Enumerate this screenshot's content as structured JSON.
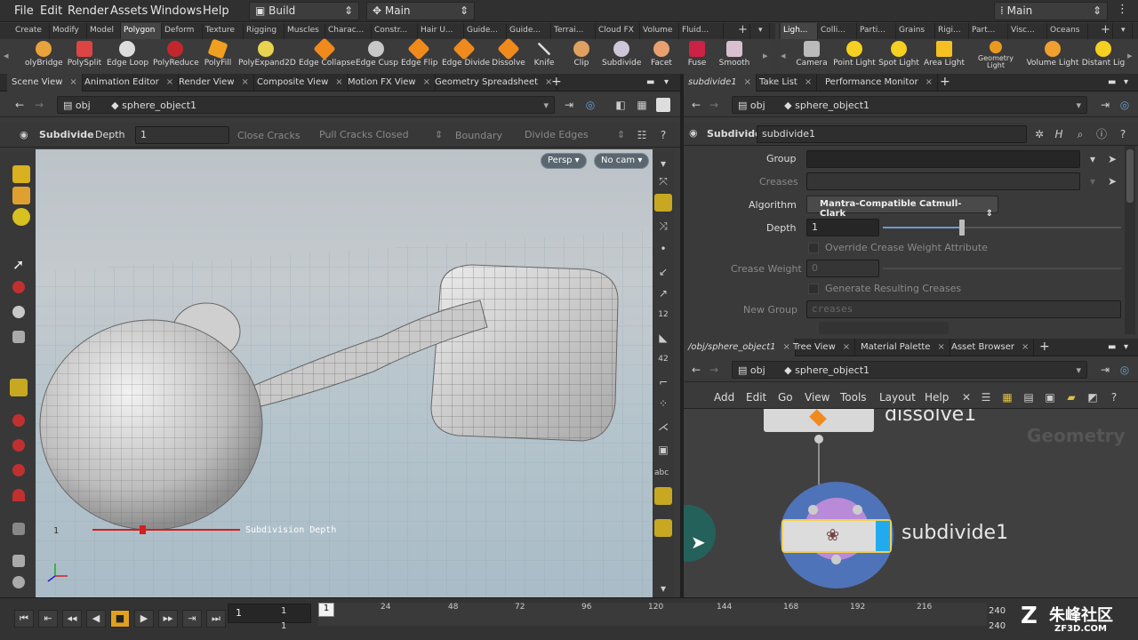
{
  "menubar": {
    "items": [
      "File",
      "Edit",
      "Render",
      "Assets",
      "Windows",
      "Help"
    ],
    "desktop": "Build",
    "context": "Main",
    "right_desktop": "Main"
  },
  "shelf_tabs_left": [
    "Create",
    "Modify",
    "Model",
    "Polygon",
    "Deform",
    "Texture",
    "Rigging",
    "Muscles",
    "Charac...",
    "Constr...",
    "Hair U...",
    "Guide...",
    "Guide...",
    "Terrai...",
    "Cloud FX",
    "Volume",
    "Fluid..."
  ],
  "shelf_tabs_right": [
    "Ligh...",
    "Colli...",
    "Parti...",
    "Grains",
    "Rigi...",
    "Part...",
    "Visc...",
    "Oceans"
  ],
  "tools_left": [
    "olyBridge",
    "PolySplit",
    "Edge Loop",
    "PolyReduce",
    "PolyFill",
    "PolyExpand2D",
    "Edge Collapse",
    "Edge Cusp",
    "Edge Flip",
    "Edge Divide",
    "Dissolve",
    "Knife",
    "Clip",
    "Subdivide",
    "Facet",
    "Fuse",
    "Smooth"
  ],
  "tools_right": [
    "Camera",
    "Point Light",
    "Spot Light",
    "Area Light",
    "Geometry Light",
    "Volume Light",
    "Distant Lig"
  ],
  "left_pane_tabs": [
    "Scene View",
    "Animation Editor",
    "Render View",
    "Composite View",
    "Motion FX View",
    "Geometry Spreadsheet"
  ],
  "path": {
    "root": "obj",
    "object": "sphere_object1"
  },
  "opbar": {
    "op": "Subdivide",
    "depth_label": "Depth",
    "depth_value": "1",
    "close_cracks": "Close Cracks",
    "pull_cracks": "Pull Cracks Closed",
    "boundary": "Boundary",
    "divide_edges": "Divide Edges"
  },
  "viewport": {
    "persp": "Persp",
    "cam": "No cam",
    "handle_value": "1",
    "handle_label": "Subdivision Depth",
    "axes": "x y z"
  },
  "right_top_tabs": [
    "subdivide1",
    "Take List",
    "Performance Monitor"
  ],
  "params": {
    "op_type": "Subdivide",
    "node_name": "subdivide1",
    "group": "Group",
    "creases": "Creases",
    "algorithm_label": "Algorithm",
    "algorithm_value": "Mantra-Compatible Catmull-Clark",
    "depth_label": "Depth",
    "depth_value": "1",
    "override": "Override Crease Weight Attribute",
    "crease_weight": "Crease Weight",
    "crease_weight_value": "0",
    "generate": "Generate Resulting Creases",
    "new_group": "New Group",
    "new_group_value": "creases"
  },
  "right_bottom_tabs": [
    "/obj/sphere_object1",
    "Tree View",
    "Material Palette",
    "Asset Browser"
  ],
  "network_menu": [
    "Add",
    "Edit",
    "Go",
    "View",
    "Tools",
    "Layout",
    "Help"
  ],
  "network": {
    "context_label": "Geometry",
    "node1": "dissolve1",
    "node2": "subdivide1"
  },
  "timeline": {
    "frame": "1",
    "start": "1",
    "end": "1",
    "ticks": [
      "1",
      "24",
      "48",
      "72",
      "96",
      "120",
      "144",
      "168",
      "192",
      "216",
      "240"
    ],
    "range_end": "240",
    "range_end2": "240"
  },
  "watermark": {
    "cn": "朱峰社区",
    "url": "ZF3D.COM"
  }
}
